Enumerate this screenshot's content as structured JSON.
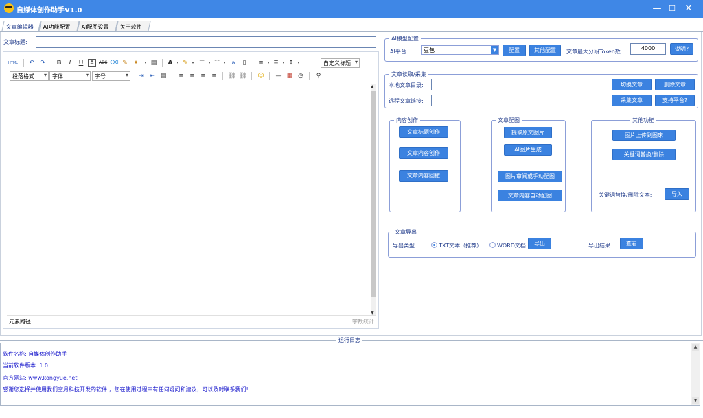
{
  "window": {
    "title": "自媒体创作助手V1.0",
    "min_icon": "minimize-icon",
    "max_icon": "maximize-icon",
    "close_icon": "close-icon"
  },
  "tabs": [
    {
      "label": "文章编辑器",
      "active": true
    },
    {
      "label": "AI功能配置",
      "active": false
    },
    {
      "label": "AI配图设置",
      "active": false
    },
    {
      "label": "关于软件",
      "active": false
    }
  ],
  "editor": {
    "title_label": "文章标题:",
    "title_value": "",
    "toolbar": {
      "paragraph_format": "段落格式",
      "font_family": "字体",
      "font_size": "字号",
      "custom_title": "自定义标题"
    },
    "element_path_label": "元素路径:",
    "word_count_label": "字数统计"
  },
  "ai_config": {
    "group_title": "AI模型配置",
    "platform_label": "AI平台:",
    "platform_value": "豆包",
    "config_button": "配置",
    "other_config_button": "其他配置",
    "max_token_label": "文章最大分段Token数:",
    "max_token_value": "4000",
    "help_button": "说明?"
  },
  "article_read": {
    "group_title": "文章读取/采集",
    "local_dir_label": "本地文章目录:",
    "local_dir_value": "",
    "switch_button": "切换文章",
    "delete_button": "删除文章",
    "remote_link_label": "远程文章链接:",
    "remote_link_value": "",
    "collect_button": "采集文章",
    "platforms_button": "支持平台?"
  },
  "content_creation": {
    "group_title": "内容创作",
    "title_button": "文章标题创作",
    "content_button": "文章内容创作",
    "restore_button": "文章内容回撤"
  },
  "article_images": {
    "group_title": "文章配图",
    "extract_button": "提取原文图片",
    "ai_gen_button": "AI图片生成",
    "review_button": "图片审阅或手动配图",
    "auto_button": "文章内容自动配图"
  },
  "other_functions": {
    "group_title": "其他功能",
    "upload_button": "图片上传到图床",
    "replace_button": "关键词替换/删除",
    "replace_text_label": "关键词替换/删除文本:",
    "import_button": "导入"
  },
  "export": {
    "group_title": "文章导出",
    "type_label": "导出类型:",
    "option_txt": "TXT文本（推荐）",
    "option_word": "WORD文档",
    "export_button": "导出",
    "result_label": "导出结果:",
    "view_button": "查看"
  },
  "log": {
    "title": "运行日志",
    "lines": [
      "软件名称: 自媒体创作助手",
      "当前软件版本: 1.0",
      "官方网站: www.kongyue.net",
      "感谢您选择并使用我们空月科技开发的软件 ，您在使用过程中有任何疑问和建议，可以及时联系我们!"
    ]
  },
  "colors": {
    "accent": "#3f87e6",
    "button": "#3b82e0",
    "text": "#1f3a8a"
  }
}
